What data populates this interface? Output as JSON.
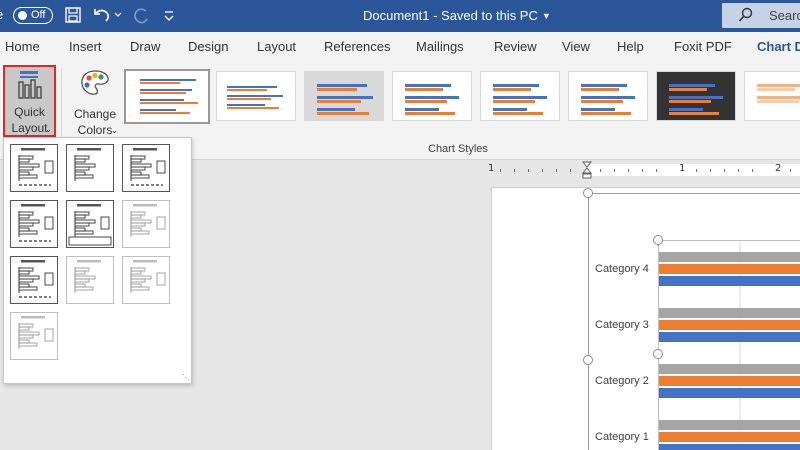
{
  "titlebar": {
    "autosave_prefix": "e",
    "autosave_state": "Off",
    "document_title": "Document1  -  Saved to this PC",
    "search_label": "Search"
  },
  "tabs": [
    "Home",
    "Insert",
    "Draw",
    "Design",
    "Layout",
    "References",
    "Mailings",
    "Review",
    "View",
    "Help",
    "Foxit PDF",
    "Chart D"
  ],
  "active_tab": "Chart D",
  "ribbon": {
    "quick_layout_line1": "Quick",
    "quick_layout_line2": "Layout",
    "change_colors_line1": "Change",
    "change_colors_line2": "Colors",
    "group_label": "Chart Styles"
  },
  "ruler": {
    "numbers": [
      "1",
      "1",
      "2"
    ]
  },
  "chart": {
    "categories": [
      "Category 4",
      "Category 3",
      "Category 2",
      "Category 1"
    ],
    "series_colors": [
      "#a5a5a5",
      "#ed7d31",
      "#4472c4"
    ]
  },
  "quick_layout": {
    "count": 10,
    "selected_index": 0
  },
  "colors": {
    "title_bar": "#2b579a",
    "highlight": "#e02828"
  }
}
